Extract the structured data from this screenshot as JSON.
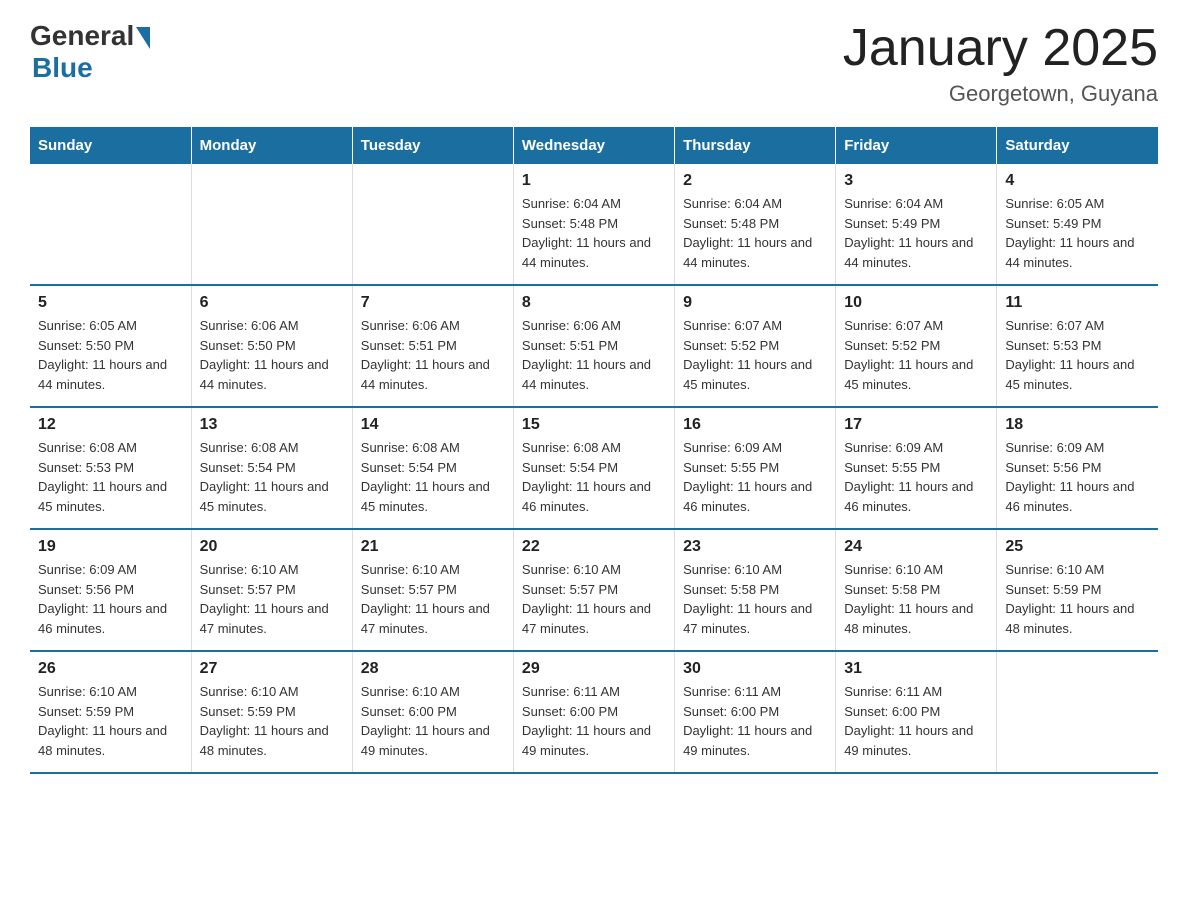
{
  "header": {
    "logo": {
      "general": "General",
      "blue": "Blue"
    },
    "title": "January 2025",
    "subtitle": "Georgetown, Guyana"
  },
  "weekdays": [
    "Sunday",
    "Monday",
    "Tuesday",
    "Wednesday",
    "Thursday",
    "Friday",
    "Saturday"
  ],
  "weeks": [
    [
      {
        "day": "",
        "sunrise": "",
        "sunset": "",
        "daylight": ""
      },
      {
        "day": "",
        "sunrise": "",
        "sunset": "",
        "daylight": ""
      },
      {
        "day": "",
        "sunrise": "",
        "sunset": "",
        "daylight": ""
      },
      {
        "day": "1",
        "sunrise": "Sunrise: 6:04 AM",
        "sunset": "Sunset: 5:48 PM",
        "daylight": "Daylight: 11 hours and 44 minutes."
      },
      {
        "day": "2",
        "sunrise": "Sunrise: 6:04 AM",
        "sunset": "Sunset: 5:48 PM",
        "daylight": "Daylight: 11 hours and 44 minutes."
      },
      {
        "day": "3",
        "sunrise": "Sunrise: 6:04 AM",
        "sunset": "Sunset: 5:49 PM",
        "daylight": "Daylight: 11 hours and 44 minutes."
      },
      {
        "day": "4",
        "sunrise": "Sunrise: 6:05 AM",
        "sunset": "Sunset: 5:49 PM",
        "daylight": "Daylight: 11 hours and 44 minutes."
      }
    ],
    [
      {
        "day": "5",
        "sunrise": "Sunrise: 6:05 AM",
        "sunset": "Sunset: 5:50 PM",
        "daylight": "Daylight: 11 hours and 44 minutes."
      },
      {
        "day": "6",
        "sunrise": "Sunrise: 6:06 AM",
        "sunset": "Sunset: 5:50 PM",
        "daylight": "Daylight: 11 hours and 44 minutes."
      },
      {
        "day": "7",
        "sunrise": "Sunrise: 6:06 AM",
        "sunset": "Sunset: 5:51 PM",
        "daylight": "Daylight: 11 hours and 44 minutes."
      },
      {
        "day": "8",
        "sunrise": "Sunrise: 6:06 AM",
        "sunset": "Sunset: 5:51 PM",
        "daylight": "Daylight: 11 hours and 44 minutes."
      },
      {
        "day": "9",
        "sunrise": "Sunrise: 6:07 AM",
        "sunset": "Sunset: 5:52 PM",
        "daylight": "Daylight: 11 hours and 45 minutes."
      },
      {
        "day": "10",
        "sunrise": "Sunrise: 6:07 AM",
        "sunset": "Sunset: 5:52 PM",
        "daylight": "Daylight: 11 hours and 45 minutes."
      },
      {
        "day": "11",
        "sunrise": "Sunrise: 6:07 AM",
        "sunset": "Sunset: 5:53 PM",
        "daylight": "Daylight: 11 hours and 45 minutes."
      }
    ],
    [
      {
        "day": "12",
        "sunrise": "Sunrise: 6:08 AM",
        "sunset": "Sunset: 5:53 PM",
        "daylight": "Daylight: 11 hours and 45 minutes."
      },
      {
        "day": "13",
        "sunrise": "Sunrise: 6:08 AM",
        "sunset": "Sunset: 5:54 PM",
        "daylight": "Daylight: 11 hours and 45 minutes."
      },
      {
        "day": "14",
        "sunrise": "Sunrise: 6:08 AM",
        "sunset": "Sunset: 5:54 PM",
        "daylight": "Daylight: 11 hours and 45 minutes."
      },
      {
        "day": "15",
        "sunrise": "Sunrise: 6:08 AM",
        "sunset": "Sunset: 5:54 PM",
        "daylight": "Daylight: 11 hours and 46 minutes."
      },
      {
        "day": "16",
        "sunrise": "Sunrise: 6:09 AM",
        "sunset": "Sunset: 5:55 PM",
        "daylight": "Daylight: 11 hours and 46 minutes."
      },
      {
        "day": "17",
        "sunrise": "Sunrise: 6:09 AM",
        "sunset": "Sunset: 5:55 PM",
        "daylight": "Daylight: 11 hours and 46 minutes."
      },
      {
        "day": "18",
        "sunrise": "Sunrise: 6:09 AM",
        "sunset": "Sunset: 5:56 PM",
        "daylight": "Daylight: 11 hours and 46 minutes."
      }
    ],
    [
      {
        "day": "19",
        "sunrise": "Sunrise: 6:09 AM",
        "sunset": "Sunset: 5:56 PM",
        "daylight": "Daylight: 11 hours and 46 minutes."
      },
      {
        "day": "20",
        "sunrise": "Sunrise: 6:10 AM",
        "sunset": "Sunset: 5:57 PM",
        "daylight": "Daylight: 11 hours and 47 minutes."
      },
      {
        "day": "21",
        "sunrise": "Sunrise: 6:10 AM",
        "sunset": "Sunset: 5:57 PM",
        "daylight": "Daylight: 11 hours and 47 minutes."
      },
      {
        "day": "22",
        "sunrise": "Sunrise: 6:10 AM",
        "sunset": "Sunset: 5:57 PM",
        "daylight": "Daylight: 11 hours and 47 minutes."
      },
      {
        "day": "23",
        "sunrise": "Sunrise: 6:10 AM",
        "sunset": "Sunset: 5:58 PM",
        "daylight": "Daylight: 11 hours and 47 minutes."
      },
      {
        "day": "24",
        "sunrise": "Sunrise: 6:10 AM",
        "sunset": "Sunset: 5:58 PM",
        "daylight": "Daylight: 11 hours and 48 minutes."
      },
      {
        "day": "25",
        "sunrise": "Sunrise: 6:10 AM",
        "sunset": "Sunset: 5:59 PM",
        "daylight": "Daylight: 11 hours and 48 minutes."
      }
    ],
    [
      {
        "day": "26",
        "sunrise": "Sunrise: 6:10 AM",
        "sunset": "Sunset: 5:59 PM",
        "daylight": "Daylight: 11 hours and 48 minutes."
      },
      {
        "day": "27",
        "sunrise": "Sunrise: 6:10 AM",
        "sunset": "Sunset: 5:59 PM",
        "daylight": "Daylight: 11 hours and 48 minutes."
      },
      {
        "day": "28",
        "sunrise": "Sunrise: 6:10 AM",
        "sunset": "Sunset: 6:00 PM",
        "daylight": "Daylight: 11 hours and 49 minutes."
      },
      {
        "day": "29",
        "sunrise": "Sunrise: 6:11 AM",
        "sunset": "Sunset: 6:00 PM",
        "daylight": "Daylight: 11 hours and 49 minutes."
      },
      {
        "day": "30",
        "sunrise": "Sunrise: 6:11 AM",
        "sunset": "Sunset: 6:00 PM",
        "daylight": "Daylight: 11 hours and 49 minutes."
      },
      {
        "day": "31",
        "sunrise": "Sunrise: 6:11 AM",
        "sunset": "Sunset: 6:00 PM",
        "daylight": "Daylight: 11 hours and 49 minutes."
      },
      {
        "day": "",
        "sunrise": "",
        "sunset": "",
        "daylight": ""
      }
    ]
  ]
}
